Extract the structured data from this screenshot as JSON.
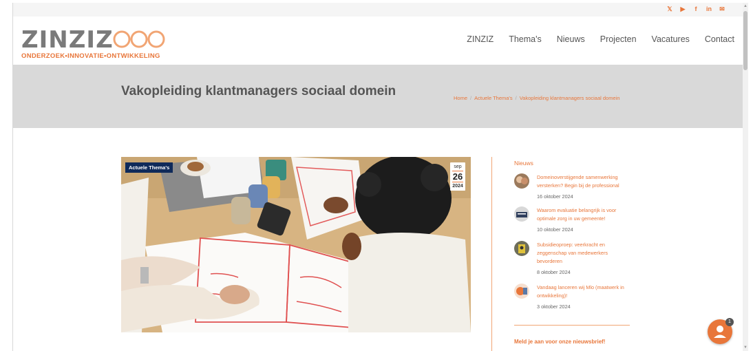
{
  "social": {
    "x": "𝕏",
    "youtube": "▶",
    "facebook": "f",
    "linkedin": "in",
    "mail": "✉"
  },
  "logo": {
    "word": "ZINZIZ",
    "tagline": "ONDERZOEK•INNOVATIE•ONTWIKKELING"
  },
  "nav": [
    "ZINZIZ",
    "Thema's",
    "Nieuws",
    "Projecten",
    "Vacatures",
    "Contact"
  ],
  "page": {
    "title": "Vakopleiding klantmanagers sociaal domein"
  },
  "breadcrumb": {
    "home": "Home",
    "section": "Actuele Thema's",
    "current": "Vakopleiding klantmanagers sociaal domein",
    "sep": "/"
  },
  "post": {
    "category": "Actuele Thema's",
    "month": "sep",
    "day": "26",
    "year": "2024"
  },
  "sidebar": {
    "heading": "Nieuws",
    "items": [
      {
        "title": "Domeinoverstijgende samenwerking versterken? Begin bij de professional",
        "date": "16 oktober 2024"
      },
      {
        "title": "Waarom evaluatie belangrijk is voor optimale zorg in uw gemeente!",
        "date": "10 oktober 2024"
      },
      {
        "title": "Subsidieoproep: veerkracht en zeggenschap van medewerkers bevorderen",
        "date": "8 oktober 2024"
      },
      {
        "title": "Vandaag lanceren wij Mlo (maatwerk in ontwikkeling)!",
        "date": "3 oktober 2024"
      }
    ],
    "newsletter": "Meld je aan voor onze nieuwsbrief!"
  },
  "chat": {
    "count": "1"
  },
  "colors": {
    "accent": "#e8763a",
    "badge": "#0f2a5a"
  }
}
